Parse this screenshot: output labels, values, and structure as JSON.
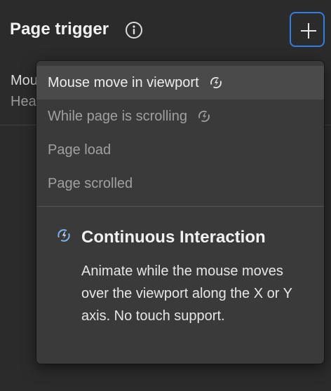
{
  "header": {
    "title": "Page trigger"
  },
  "icons": {
    "info": "info-circle-icon",
    "add": "plus-icon",
    "continuous": "continuous-interaction-icon"
  },
  "background_item": {
    "title": "Mou",
    "subtitle": "Hea"
  },
  "menu": {
    "items": [
      {
        "label": "Mouse move in viewport",
        "continuous": true,
        "highlighted": true
      },
      {
        "label": "While page is scrolling",
        "continuous": true,
        "highlighted": false
      },
      {
        "label": "Page load",
        "continuous": false,
        "highlighted": false
      },
      {
        "label": "Page scrolled",
        "continuous": false,
        "highlighted": false
      }
    ],
    "info": {
      "heading": "Continuous Interaction",
      "description": "Animate while the mouse moves over the viewport along the X or Y axis. No touch support."
    }
  },
  "colors": {
    "accent": "#2f7fe0",
    "background": "#2b2b2b",
    "menu_background": "#3a3a3a",
    "icon_blue": "#7fb2f0"
  }
}
